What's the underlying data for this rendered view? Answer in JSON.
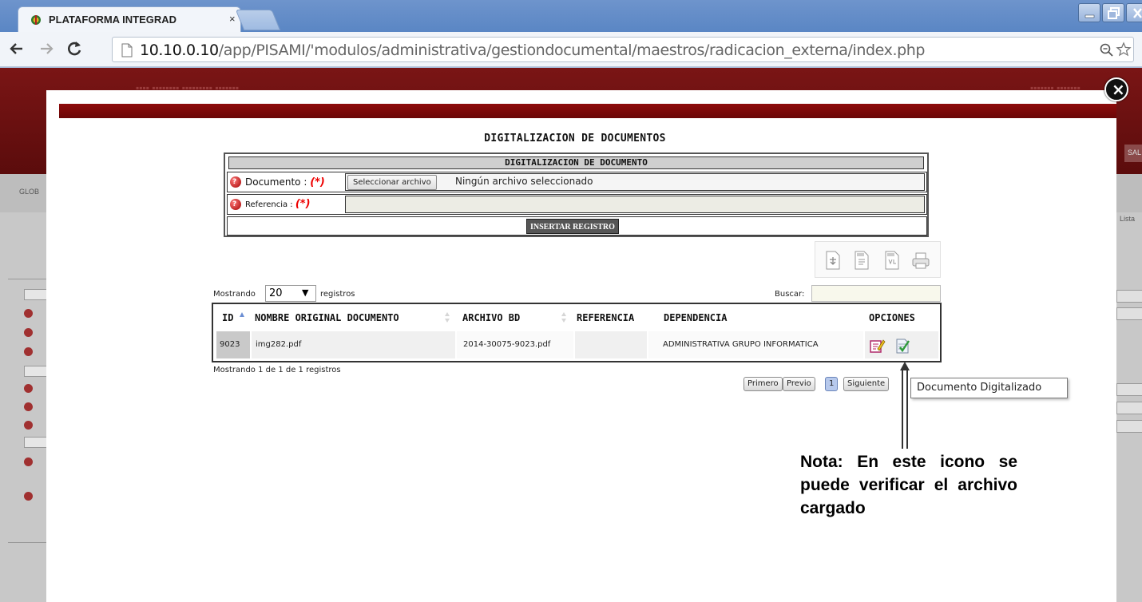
{
  "browser": {
    "tab_title": "PLATAFORMA INTEGRAD",
    "tab_close": "×",
    "url_host": "10.10.0.10",
    "url_path": "/app/PISAMI/'modulos/administrativa/gestiondocumental/maestros/radicacion_externa/index.php",
    "icons": [
      "favicon-icon",
      "back-arrow-icon",
      "forward-arrow-icon",
      "reload-icon",
      "page-icon",
      "zoom-icon",
      "star-icon",
      "minimize-icon",
      "maximize-icon",
      "close-window-icon"
    ]
  },
  "background_app": {
    "glob_text": "GLOB",
    "lista_text": "Lista",
    "sal_button": "SAL"
  },
  "modal": {
    "close_symbol": "×",
    "page_title": "DIGITALIZACION DE DOCUMENTOS",
    "form": {
      "header": "DIGITALIZACION DE DOCUMENTO",
      "documento_label": "Documento : ",
      "referencia_label": "Referencia : ",
      "required_mark": "(*)",
      "file_button": "Seleccionar archivo",
      "file_status": "Ningún archivo seleccionado",
      "referencia_value": "",
      "submit": "INSERTAR REGISTRO"
    },
    "export_icons": [
      "export-copy-icon",
      "export-csv-icon",
      "export-excel-icon",
      "print-icon"
    ],
    "table": {
      "length_prefix": "Mostrando",
      "length_value": "20",
      "length_arrow": "▼",
      "length_suffix": "registros",
      "search_label": "Buscar:",
      "search_value": "",
      "headers": {
        "id": "ID",
        "nombre": "NOMBRE ORIGINAL DOCUMENTO",
        "archivo": "ARCHIVO BD",
        "referencia": "REFERENCIA",
        "dependencia": "DEPENDENCIA",
        "opciones": "OPCIONES"
      },
      "rows": [
        {
          "id": "9023",
          "nombre": "img282.pdf",
          "archivo": "2014-30075-9023.pdf",
          "referencia": "",
          "dependencia": "ADMINISTRATIVA GRUPO INFORMATICA"
        }
      ],
      "info": "Mostrando 1 de 1 de 1 registros",
      "pagination": {
        "first": "Primero",
        "prev": "Previo",
        "current": "1",
        "next": "Siguiente"
      }
    },
    "tooltip": "Documento Digitalizado",
    "note": "Nota: En este icono se puede verificar el archivo cargado"
  },
  "colors": {
    "header_red": "#7a1515",
    "modal_bar_red": "#8e0c0c",
    "required_red": "#e00000",
    "active_page_blue": "#b7c9ec"
  }
}
